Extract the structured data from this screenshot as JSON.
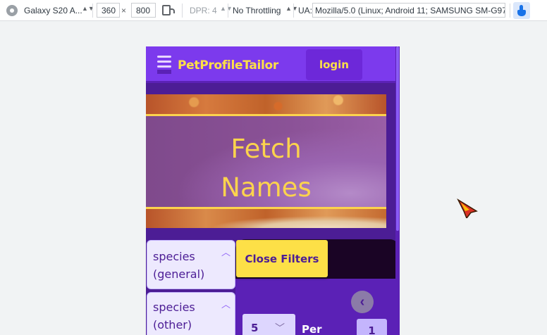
{
  "devtools": {
    "device": "Galaxy S20 A...",
    "width": "360",
    "times": "×",
    "height": "800",
    "dpr": "DPR: 4",
    "throttling": "No Throttling",
    "ua_label": "UA:",
    "ua_value": "Mozilla/5.0 (Linux; Android 11; SAMSUNG SM-G97"
  },
  "header": {
    "brand": "PetProfileTailor",
    "login": "login"
  },
  "hero": {
    "title_line1": "Fetch",
    "title_line2": "Names"
  },
  "filters": {
    "items": [
      {
        "line1": "species",
        "line2": "(general)"
      },
      {
        "line1": "species",
        "line2": "(other)"
      }
    ],
    "close_label": "Close Filters"
  },
  "pagination": {
    "per_value": "5",
    "per_label": "Per",
    "page": "1"
  },
  "colors": {
    "header_bg": "#7c3aed",
    "accent_yellow": "#fde047",
    "page_bg": "#4c1d95"
  }
}
